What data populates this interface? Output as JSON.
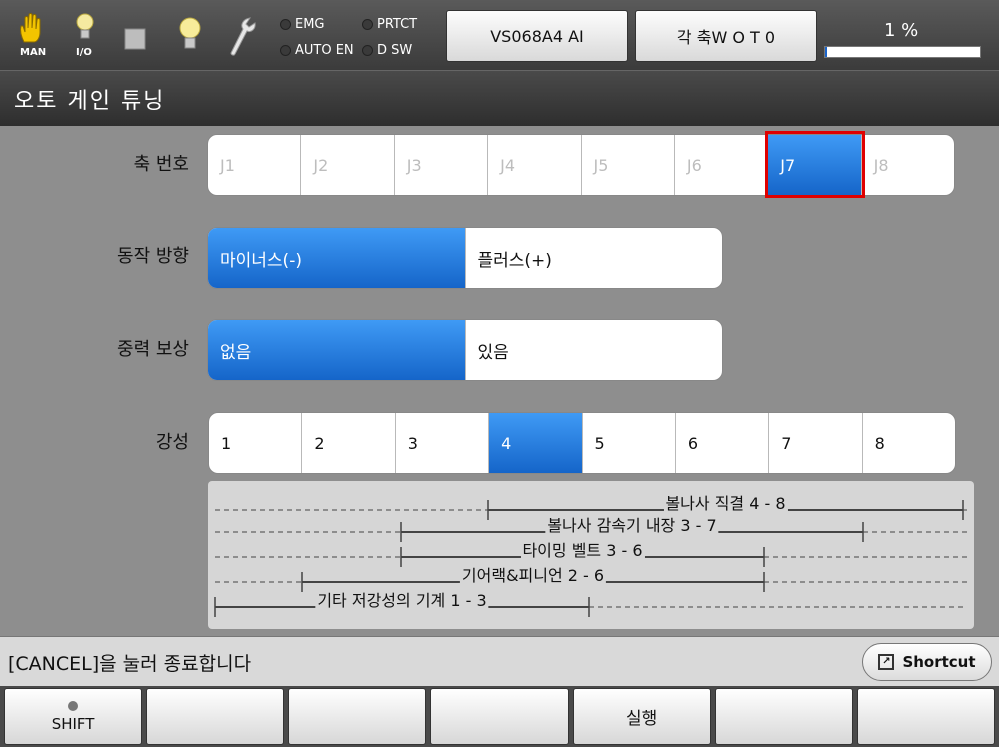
{
  "header": {
    "icons": [
      {
        "name": "hand-icon",
        "label": "MAN"
      },
      {
        "name": "bulb-io-icon",
        "label": "I/O"
      },
      {
        "name": "stop-square-icon",
        "label": ""
      },
      {
        "name": "bulb-icon",
        "label": ""
      },
      {
        "name": "wrench-icon",
        "label": ""
      }
    ],
    "indicators": {
      "emg": "EMG",
      "prtct": "PRTCT",
      "auto_en": "AUTO EN",
      "dsw": "D SW"
    },
    "robot_button": "VS068A4 AI",
    "axis_button": "각 축W O T 0",
    "percent_text": "1 %",
    "percent_value": 1
  },
  "title": "오토 게인 튜닝",
  "axis_row": {
    "label": "축 번호",
    "options": [
      "J1",
      "J2",
      "J3",
      "J4",
      "J5",
      "J6",
      "J7",
      "J8"
    ],
    "selected": "J7"
  },
  "direction_row": {
    "label": "동작 방향",
    "options": [
      "마이너스(-)",
      "플러스(+)"
    ],
    "selected": "마이너스(-)"
  },
  "gravity_row": {
    "label": "중력 보상",
    "options": [
      "없음",
      "있음"
    ],
    "selected": "없음"
  },
  "stiffness_row": {
    "label": "강성",
    "options": [
      "1",
      "2",
      "3",
      "4",
      "5",
      "6",
      "7",
      "8"
    ],
    "selected": "4"
  },
  "guide": {
    "ranges": [
      {
        "label": "볼나사 직결 4 - 8",
        "from": 4,
        "to": 8
      },
      {
        "label": "볼나사 감속기 내장 3 - 7",
        "from": 3,
        "to": 7
      },
      {
        "label": "타이밍 벨트 3 - 6",
        "from": 3,
        "to": 6
      },
      {
        "label": "기어랙&피니언 2 - 6",
        "from": 2,
        "to": 6
      },
      {
        "label": "기타 저강성의 기계 1 - 3",
        "from": 1,
        "to": 3
      }
    ]
  },
  "status": {
    "message": "[CANCEL]을 눌러 종료합니다",
    "shortcut": "Shortcut"
  },
  "fkeys": [
    "SHIFT",
    "",
    "",
    "",
    "실행",
    "",
    ""
  ]
}
